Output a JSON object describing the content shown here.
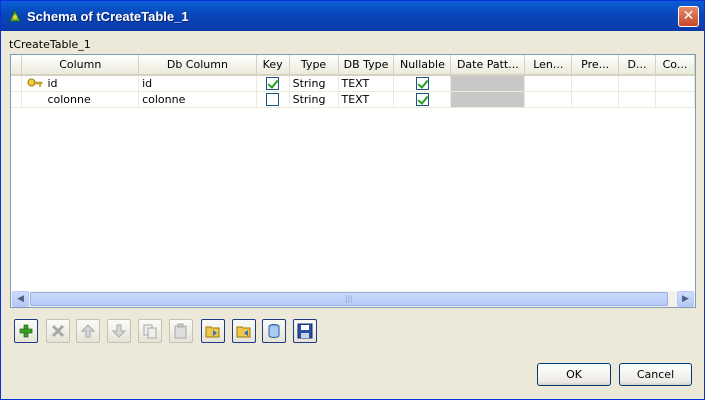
{
  "window": {
    "title": "Schema of tCreateTable_1",
    "close_label": "✕"
  },
  "subtitle": "tCreateTable_1",
  "table": {
    "columns": [
      "Column",
      "Db Column",
      "Key",
      "Type",
      "DB Type",
      "Nullable",
      "Date Patt...",
      "Len...",
      "Pre...",
      "D...",
      "Co..."
    ],
    "rows": [
      {
        "column": "id",
        "db_column": "id",
        "key": true,
        "type": "String",
        "db_type": "TEXT",
        "nullable": true,
        "key_icon": "key-icon"
      },
      {
        "column": "colonne",
        "db_column": "colonne",
        "key": false,
        "type": "String",
        "db_type": "TEXT",
        "nullable": true
      }
    ]
  },
  "toolbar": {
    "buttons": [
      {
        "name": "add-icon",
        "enabled": true
      },
      {
        "name": "remove-icon",
        "enabled": false
      },
      {
        "name": "move-up-icon",
        "enabled": false
      },
      {
        "name": "move-down-icon",
        "enabled": false
      },
      {
        "name": "copy-icon",
        "enabled": false
      },
      {
        "name": "paste-icon",
        "enabled": false
      },
      {
        "name": "import-icon",
        "enabled": true
      },
      {
        "name": "export-icon",
        "enabled": true
      },
      {
        "name": "repository-icon",
        "enabled": true
      },
      {
        "name": "save-icon",
        "enabled": true
      }
    ]
  },
  "buttons": {
    "ok": "OK",
    "cancel": "Cancel"
  },
  "colors": {
    "titlebar": "#0846b9",
    "grid_border": "#7f9db9",
    "check": "#21a121",
    "dialog_bg": "#ece9d8"
  }
}
